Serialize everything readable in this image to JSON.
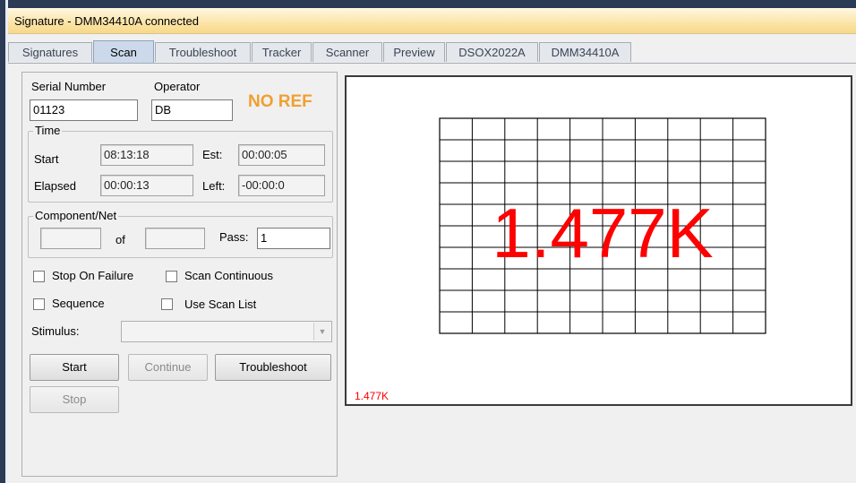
{
  "window": {
    "title": "Signature - DMM34410A connected"
  },
  "tabs": [
    {
      "label": "Signatures",
      "active": false
    },
    {
      "label": "Scan",
      "active": true
    },
    {
      "label": "Troubleshoot",
      "active": false
    },
    {
      "label": "Tracker",
      "active": false
    },
    {
      "label": "Scanner",
      "active": false
    },
    {
      "label": "Preview",
      "active": false
    },
    {
      "label": "DSOX2022A",
      "active": false
    },
    {
      "label": "DMM34410A",
      "active": false
    }
  ],
  "scan": {
    "serial_label": "Serial Number",
    "serial_value": "01123",
    "operator_label": "Operator",
    "operator_value": "DB",
    "ref_status": "NO REF",
    "ref_status_color": "#f0a030",
    "time": {
      "group_label": "Time",
      "start_label": "Start",
      "start_value": "08:13:18",
      "est_label": "Est:",
      "est_value": "00:00:05",
      "elapsed_label": "Elapsed",
      "elapsed_value": "00:00:13",
      "left_label": "Left:",
      "left_value": "-00:00:0"
    },
    "component": {
      "group_label": "Component/Net",
      "index_value": "",
      "of_label": "of",
      "total_value": "",
      "pass_label": "Pass:",
      "pass_value": "1"
    },
    "options": {
      "stop_on_failure": "Stop On Failure",
      "scan_continuous": "Scan Continuous",
      "sequence": "Sequence",
      "use_scan_list": "Use Scan List"
    },
    "stimulus_label": "Stimulus:",
    "stimulus_value": "",
    "buttons": {
      "start": "Start",
      "continue": "Continue",
      "troubleshoot": "Troubleshoot",
      "stop": "Stop"
    }
  },
  "display": {
    "reading": "1.477K",
    "corner_reading": "1.477K",
    "reading_color": "#ff0000",
    "grid_columns": 10,
    "grid_rows": 10
  }
}
